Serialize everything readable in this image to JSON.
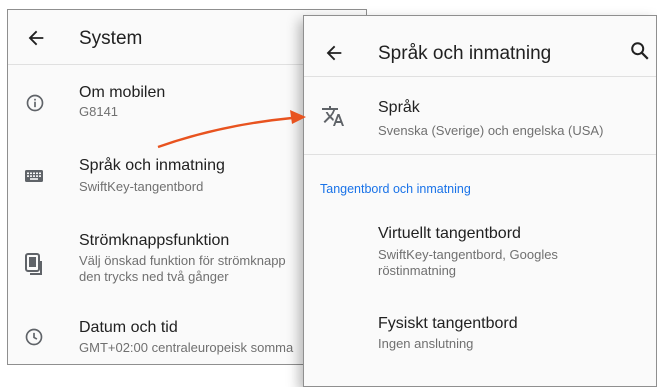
{
  "left_screen": {
    "title": "System",
    "items": [
      {
        "label": "Om mobilen",
        "sub": "G8141",
        "icon": "info-icon"
      },
      {
        "label": "Språk och inmatning",
        "sub": "SwiftKey-tangentbord",
        "icon": "keyboard-icon"
      },
      {
        "label": "Strömknappsfunktion",
        "sub1": "Välj önskad funktion för strömknapp",
        "sub2": "den trycks ned två gånger",
        "icon": "phone-power-icon"
      },
      {
        "label": "Datum och tid",
        "sub": "GMT+02:00 centraleuropeisk somma",
        "icon": "clock-icon"
      }
    ]
  },
  "right_screen": {
    "title": "Språk och inmatning",
    "language": {
      "label": "Språk",
      "sub": "Svenska (Sverige) och engelska (USA)",
      "icon": "translate-icon"
    },
    "section_header": "Tangentbord och inmatning",
    "virtual_keyboard": {
      "label": "Virtuellt tangentbord",
      "sub1": "SwiftKey-tangentbord, Googles",
      "sub2": "röstinmatning"
    },
    "physical_keyboard": {
      "label": "Fysiskt tangentbord",
      "sub": "Ingen anslutning"
    }
  },
  "colors": {
    "arrow": "#e8531f",
    "accent": "#1a73e8",
    "text_primary": "#212121",
    "text_secondary": "#707070",
    "icon": "#5f6368"
  }
}
